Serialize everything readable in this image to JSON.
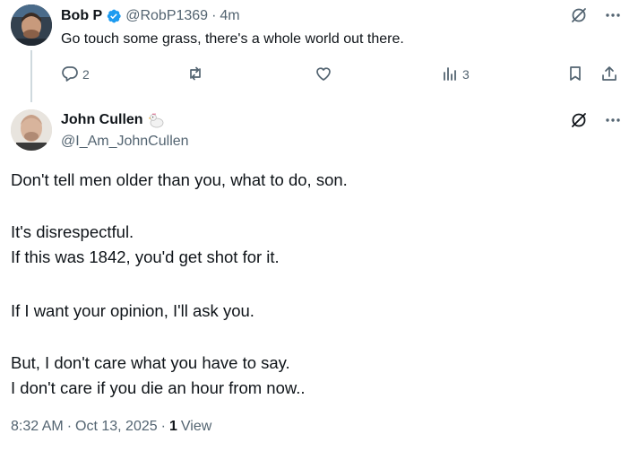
{
  "reply": {
    "author_name": "Bob P",
    "handle": "@RobP1369",
    "separator": "·",
    "time": "4m",
    "text": "Go touch some grass, there's a whole world out there.",
    "replies": "2",
    "views": "3"
  },
  "main": {
    "author_name": "John Cullen",
    "handle": "@I_Am_JohnCullen",
    "lines": [
      "Don't tell men older than you, what to do, son.",
      "It's disrespectful.",
      "If this was 1842, you'd get shot for it.",
      "If I want your opinion, I'll ask you.",
      "But, I don't care what you have to say.",
      "I don't care if you die an hour from now.."
    ],
    "time": "8:32 AM",
    "date": "Oct 13, 2025",
    "separator": "·",
    "view_count": "1",
    "view_label": "View"
  },
  "colors": {
    "text_primary": "#0f1419",
    "text_secondary": "#536471",
    "verified_blue": "#1d9bf0",
    "thread_line": "#cfd9de"
  },
  "icons": [
    "grok-icon",
    "more-icon",
    "reply-icon",
    "retweet-icon",
    "like-icon",
    "views-icon",
    "bookmark-icon",
    "share-icon",
    "verified-badge-icon",
    "chicken-emoji-icon"
  ]
}
